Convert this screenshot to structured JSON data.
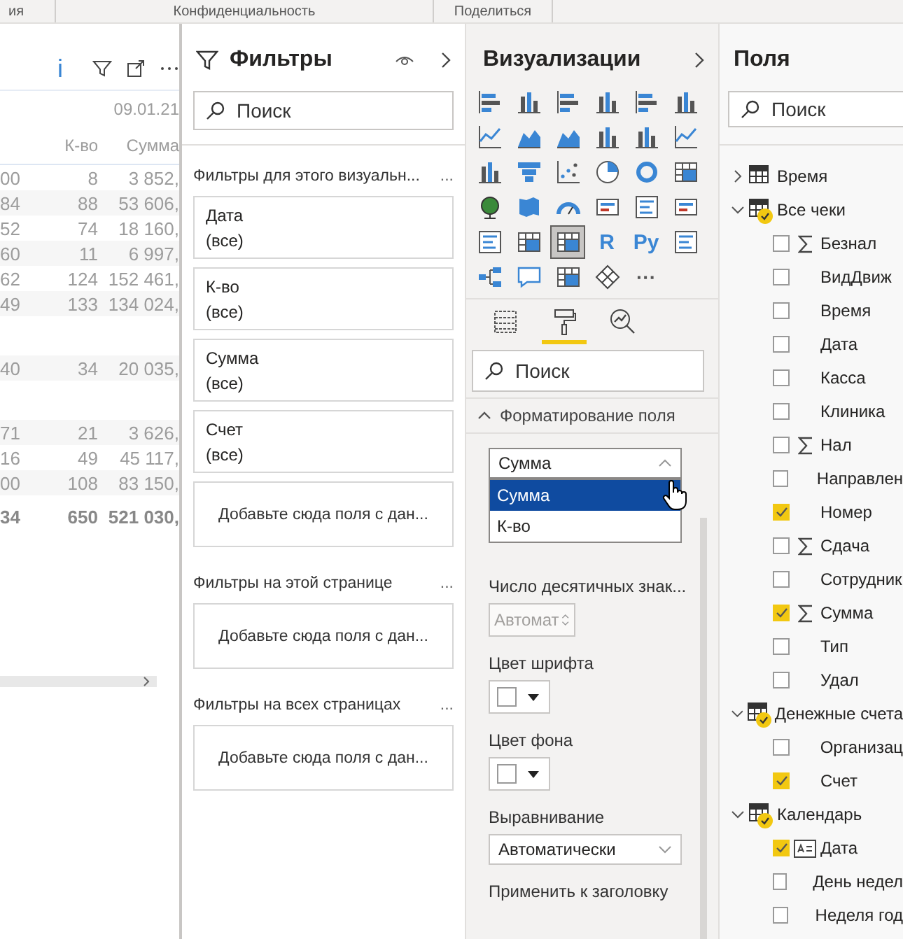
{
  "ribbon": {
    "groups": [
      "ия",
      "Конфиденциальность",
      "Поделиться"
    ]
  },
  "table_visual": {
    "title_fragment": "i",
    "group_header": "09.01.21",
    "columns": [
      "",
      "К-во",
      "Сумма"
    ],
    "rows": [
      {
        "kind": "data",
        "cells": [
          "00",
          "8",
          "3 852,"
        ]
      },
      {
        "kind": "data",
        "cells": [
          "84",
          "88",
          "53 606,"
        ]
      },
      {
        "kind": "data",
        "cells": [
          "52",
          "74",
          "18 160,"
        ]
      },
      {
        "kind": "data",
        "cells": [
          "60",
          "11",
          "6 997,"
        ]
      },
      {
        "kind": "data",
        "cells": [
          "62",
          "124",
          "152 461,"
        ]
      },
      {
        "kind": "data",
        "cells": [
          "49",
          "133",
          "134 024,"
        ]
      },
      {
        "kind": "blank",
        "cells": []
      },
      {
        "kind": "data",
        "cells": [
          "40",
          "34",
          "20 035,"
        ]
      },
      {
        "kind": "blank",
        "cells": []
      },
      {
        "kind": "data",
        "cells": [
          "71",
          "21",
          "3 626,"
        ]
      },
      {
        "kind": "data",
        "cells": [
          "16",
          "49",
          "45 117,"
        ]
      },
      {
        "kind": "data",
        "cells": [
          "00",
          "108",
          "83 150,"
        ]
      },
      {
        "kind": "total",
        "cells": [
          "34",
          "650",
          "521 030,"
        ]
      }
    ]
  },
  "filters": {
    "title": "Фильтры",
    "search": {
      "placeholder": "Поиск"
    },
    "sections": [
      {
        "title": "Фильтры для этого визуальн...",
        "more": "...",
        "cards": [
          {
            "kind": "filter",
            "field": "Дата",
            "value": "(все)"
          },
          {
            "kind": "filter",
            "field": "К-во",
            "value": "(все)"
          },
          {
            "kind": "filter",
            "field": "Сумма",
            "value": "(все)"
          },
          {
            "kind": "filter",
            "field": "Счет",
            "value": "(все)"
          },
          {
            "kind": "drop",
            "text": "Добавьте сюда поля с дан..."
          }
        ]
      },
      {
        "title": "Фильтры на этой странице",
        "more": "...",
        "cards": [
          {
            "kind": "drop",
            "text": "Добавьте сюда поля с дан..."
          }
        ]
      },
      {
        "title": "Фильтры на всех страницах",
        "more": "...",
        "cards": [
          {
            "kind": "drop",
            "text": "Добавьте сюда поля с дан..."
          }
        ]
      }
    ]
  },
  "visualizations": {
    "title": "Визуализации",
    "visuals": [
      {
        "kind": "hbar",
        "selected": false
      },
      {
        "kind": "vbar",
        "selected": false
      },
      {
        "kind": "hbar",
        "selected": false
      },
      {
        "kind": "vbar",
        "selected": false
      },
      {
        "kind": "hbar",
        "selected": false
      },
      {
        "kind": "vbar",
        "selected": false
      },
      {
        "kind": "line",
        "selected": false
      },
      {
        "kind": "area",
        "selected": false
      },
      {
        "kind": "area",
        "selected": false
      },
      {
        "kind": "vbar",
        "selected": false
      },
      {
        "kind": "vbar",
        "selected": false
      },
      {
        "kind": "line",
        "selected": false
      },
      {
        "kind": "vbar",
        "selected": false
      },
      {
        "kind": "funnel",
        "selected": false
      },
      {
        "kind": "scatter",
        "selected": false
      },
      {
        "kind": "pie",
        "selected": false
      },
      {
        "kind": "donut",
        "selected": false
      },
      {
        "kind": "grid",
        "selected": false
      },
      {
        "kind": "globe",
        "selected": false
      },
      {
        "kind": "map",
        "selected": false
      },
      {
        "kind": "gauge",
        "selected": false
      },
      {
        "kind": "card",
        "selected": false
      },
      {
        "kind": "list",
        "selected": false
      },
      {
        "kind": "card",
        "selected": false
      },
      {
        "kind": "list",
        "selected": false
      },
      {
        "kind": "grid",
        "selected": false
      },
      {
        "kind": "grid",
        "selected": true
      },
      {
        "kind": "glyph",
        "label": "R",
        "selected": false
      },
      {
        "kind": "glyph",
        "label": "Py",
        "selected": false
      },
      {
        "kind": "list",
        "selected": false
      },
      {
        "kind": "tree",
        "selected": false
      },
      {
        "kind": "speech",
        "selected": false
      },
      {
        "kind": "grid",
        "selected": false
      },
      {
        "kind": "diamond",
        "selected": false
      },
      {
        "kind": "more",
        "label": "···",
        "selected": false
      }
    ],
    "tabs": [
      {
        "kind": "fields",
        "selected": false
      },
      {
        "kind": "format",
        "selected": true
      },
      {
        "kind": "analytics",
        "selected": false
      }
    ],
    "search": {
      "placeholder": "Поиск"
    },
    "section": {
      "title": "Форматирование поля",
      "expanded": true
    },
    "field_dropdown": {
      "value": "Сумма",
      "options": [
        {
          "label": "Сумма",
          "selected": true
        },
        {
          "label": "К-во",
          "selected": false
        }
      ]
    },
    "decimals": {
      "label": "Число десятичных знак...",
      "value": "Автомат",
      "disabled": true
    },
    "font_color": {
      "label": "Цвет шрифта",
      "color": "#ffffff"
    },
    "background_color": {
      "label": "Цвет фона",
      "color": "#ffffff"
    },
    "alignment": {
      "label": "Выравнивание",
      "value": "Автоматически"
    },
    "apply_to_header": {
      "label": "Применить к заголовку"
    }
  },
  "fields": {
    "title": "Поля",
    "search": {
      "placeholder": "Поиск"
    },
    "tables": [
      {
        "label": "Время",
        "expanded": false,
        "has_selection": false
      },
      {
        "label": "Все чеки",
        "expanded": true,
        "has_selection": true,
        "children": [
          {
            "label": "Безнал",
            "kind": "measure",
            "checked": false
          },
          {
            "label": "ВидДвиж",
            "kind": "field",
            "checked": false
          },
          {
            "label": "Время",
            "kind": "field",
            "checked": false
          },
          {
            "label": "Дата",
            "kind": "field",
            "checked": false
          },
          {
            "label": "Касса",
            "kind": "field",
            "checked": false
          },
          {
            "label": "Клиника",
            "kind": "field",
            "checked": false
          },
          {
            "label": "Нал",
            "kind": "measure",
            "checked": false
          },
          {
            "label": "Направлен",
            "kind": "field",
            "checked": false
          },
          {
            "label": "Номер",
            "kind": "field",
            "checked": true
          },
          {
            "label": "Сдача",
            "kind": "measure",
            "checked": false
          },
          {
            "label": "Сотрудник",
            "kind": "field",
            "checked": false
          },
          {
            "label": "Сумма",
            "kind": "measure",
            "checked": true
          },
          {
            "label": "Тип",
            "kind": "field",
            "checked": false
          },
          {
            "label": "Удал",
            "kind": "field",
            "checked": false
          }
        ]
      },
      {
        "label": "Денежные счета",
        "expanded": true,
        "has_selection": true,
        "children": [
          {
            "label": "Организац",
            "kind": "field",
            "checked": false
          },
          {
            "label": "Счет",
            "kind": "field",
            "checked": true
          }
        ]
      },
      {
        "label": "Календарь",
        "expanded": true,
        "has_selection": true,
        "children": [
          {
            "label": "Дата",
            "kind": "hierarchy",
            "checked": true
          },
          {
            "label": "День недел",
            "kind": "field",
            "checked": false
          },
          {
            "label": "Неделя год",
            "kind": "field",
            "checked": false
          }
        ]
      }
    ]
  }
}
